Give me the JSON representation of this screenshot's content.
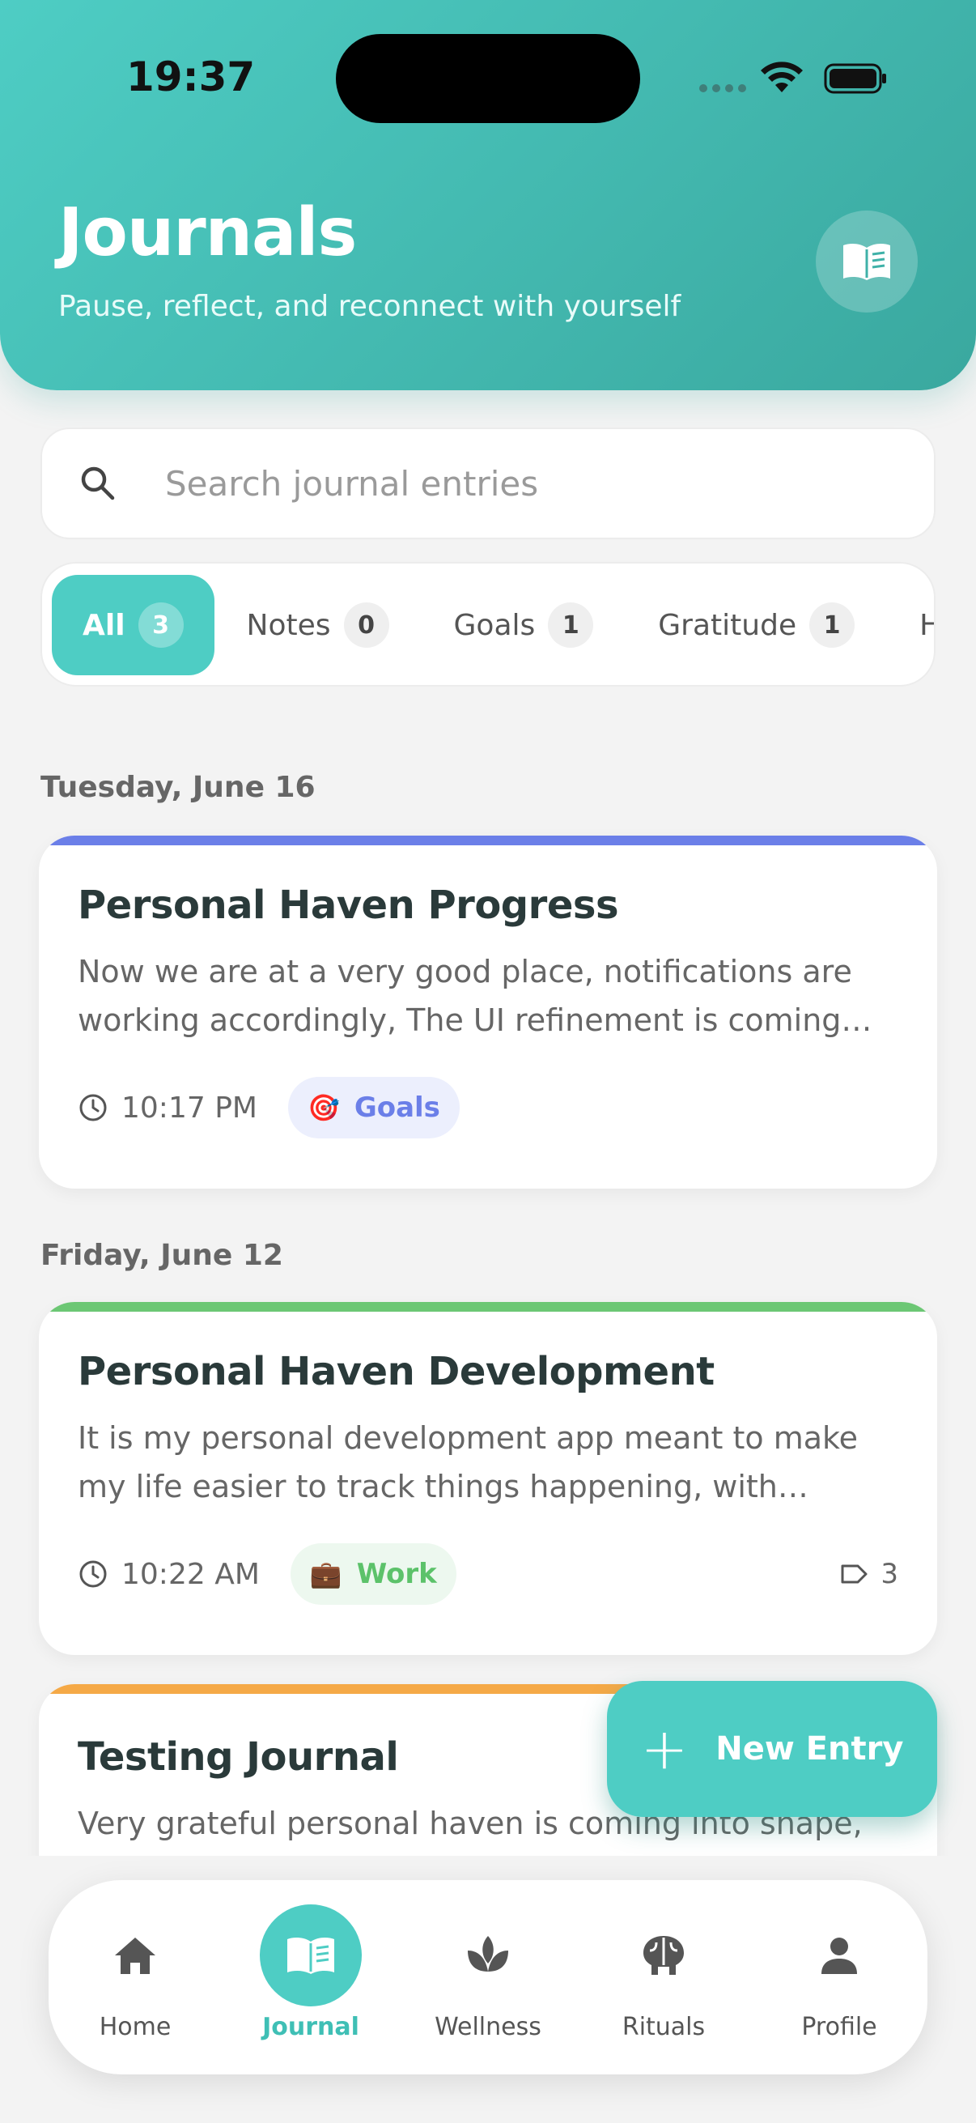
{
  "status": {
    "time": "19:37"
  },
  "header": {
    "title": "Journals",
    "subtitle": "Pause, reflect, and reconnect with yourself",
    "icon": "book-open-icon"
  },
  "search": {
    "placeholder": "Search journal entries",
    "value": ""
  },
  "filters": [
    {
      "label": "All",
      "count": "3",
      "active": true
    },
    {
      "label": "Notes",
      "count": "0",
      "active": false
    },
    {
      "label": "Goals",
      "count": "1",
      "active": false
    },
    {
      "label": "Gratitude",
      "count": "1",
      "active": false
    },
    {
      "label": "H",
      "count": "",
      "active": false
    }
  ],
  "entries": [
    {
      "date": "Tuesday, June 16",
      "title": "Personal Haven Progress",
      "body": "Now we are at a very good place, notifications are working accordingly, The UI refinement is coming along nicely and everything is taking shape.",
      "time": "10:17 PM",
      "tag": {
        "label": "Goals",
        "emoji": "🎯",
        "color": "#6b7fe8",
        "bg": "#eceffd"
      },
      "accent": "#6b7fe8",
      "tag_count": ""
    },
    {
      "date": "Friday, June 12",
      "title": "Personal Haven Development",
      "body": "It is my personal development app meant to make my life easier to track things happening, with consistent reflections and habits.",
      "time": "10:22 AM",
      "tag": {
        "label": "Work",
        "emoji": "💼",
        "color": "#5cc26a",
        "bg": "#edf8ef"
      },
      "accent": "#6cc774",
      "tag_count": "3"
    },
    {
      "title": "Testing Journal",
      "body": "Very grateful personal haven is coming into shape,",
      "accent": "#f5a947"
    }
  ],
  "fab": {
    "label": "New Entry"
  },
  "nav": [
    {
      "label": "Home",
      "icon": "home-icon",
      "active": false
    },
    {
      "label": "Journal",
      "icon": "journal-icon",
      "active": true
    },
    {
      "label": "Wellness",
      "icon": "lotus-icon",
      "active": false
    },
    {
      "label": "Rituals",
      "icon": "brain-icon",
      "active": false
    },
    {
      "label": "Profile",
      "icon": "person-icon",
      "active": false
    }
  ]
}
